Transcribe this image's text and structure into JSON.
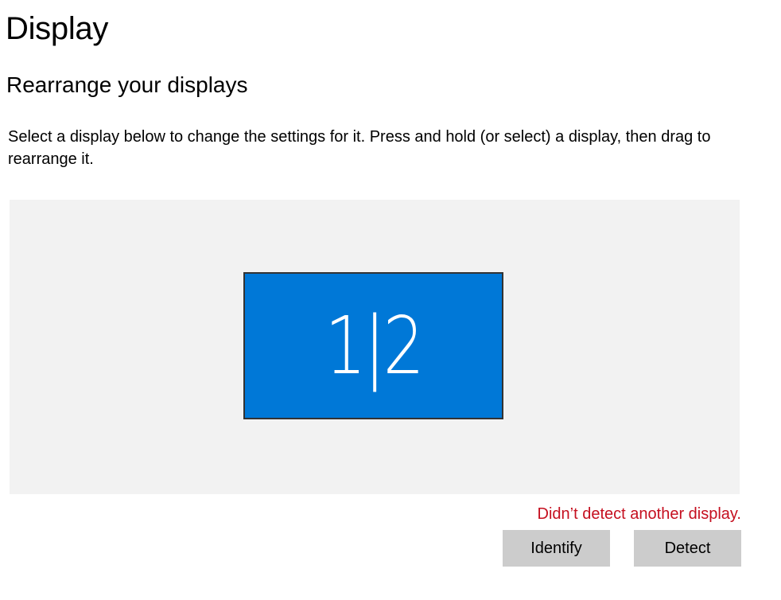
{
  "page": {
    "title": "Display"
  },
  "section": {
    "title": "Rearrange your displays",
    "description": "Select a display below to change the settings for it. Press and hold (or select) a display, then drag to rearrange it."
  },
  "arrangement": {
    "background_color": "#f2f2f2",
    "display_tile": {
      "label": "1|2",
      "color": "#0078d7",
      "border_color": "#333333"
    }
  },
  "status": {
    "message": "Didn’t detect another display.",
    "color": "#c50f1f"
  },
  "buttons": {
    "identify_label": "Identify",
    "detect_label": "Detect"
  }
}
